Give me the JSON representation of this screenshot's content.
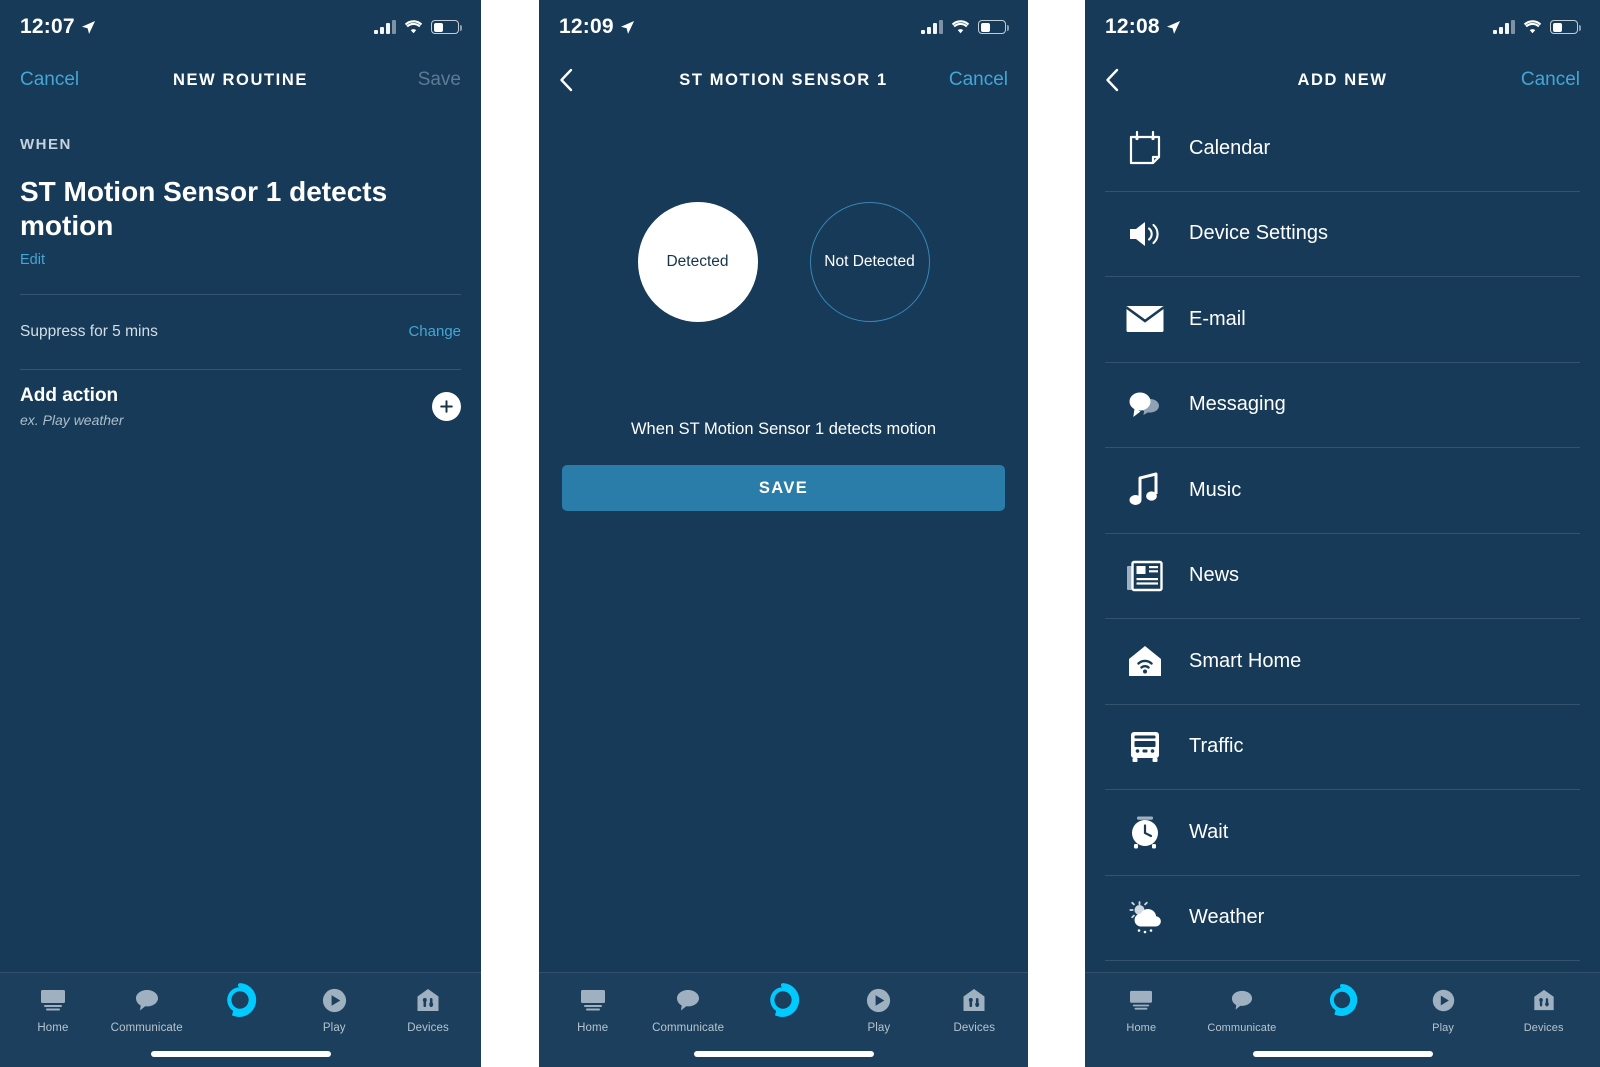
{
  "theme": {
    "bg": "#163a58",
    "accent": "#44a6d4",
    "save_button": "#2b7da9",
    "alexa_ring": "#00caff",
    "tabbar_bg": "#1b3f5d"
  },
  "panel1": {
    "status": {
      "time": "12:07",
      "location_icon": "location-arrow-icon",
      "signal_icon": "cellular-signal-icon",
      "wifi_icon": "wifi-icon",
      "battery_icon": "battery-icon"
    },
    "nav": {
      "left_label": "Cancel",
      "title": "NEW ROUTINE",
      "right_label": "Save"
    },
    "section_label": "WHEN",
    "trigger_title": "ST Motion Sensor 1 detects motion",
    "edit_label": "Edit",
    "suppress": {
      "text": "Suppress for 5 mins",
      "action_label": "Change"
    },
    "add_action": {
      "title": "Add action",
      "subtitle": "ex. Play weather",
      "button_icon": "plus-circle-icon"
    }
  },
  "panel2": {
    "status": {
      "time": "12:09",
      "location_icon": "location-arrow-icon",
      "signal_icon": "cellular-signal-icon",
      "wifi_icon": "wifi-icon",
      "battery_icon": "battery-icon"
    },
    "nav": {
      "back_icon": "chevron-left-icon",
      "title": "ST MOTION SENSOR 1",
      "right_label": "Cancel"
    },
    "options": [
      {
        "label": "Detected",
        "selected": true
      },
      {
        "label": "Not Detected",
        "selected": false
      }
    ],
    "caption": "When ST Motion Sensor 1 detects motion",
    "save_label": "SAVE"
  },
  "panel3": {
    "status": {
      "time": "12:08",
      "location_icon": "location-arrow-icon",
      "signal_icon": "cellular-signal-icon",
      "wifi_icon": "wifi-icon",
      "battery_icon": "battery-icon"
    },
    "nav": {
      "back_icon": "chevron-left-icon",
      "title": "ADD NEW",
      "right_label": "Cancel"
    },
    "items": [
      {
        "label": "Calendar",
        "icon": "calendar-icon"
      },
      {
        "label": "Device Settings",
        "icon": "speaker-volume-icon"
      },
      {
        "label": "E-mail",
        "icon": "envelope-icon"
      },
      {
        "label": "Messaging",
        "icon": "chat-bubbles-icon"
      },
      {
        "label": "Music",
        "icon": "music-note-icon"
      },
      {
        "label": "News",
        "icon": "newspaper-icon"
      },
      {
        "label": "Smart Home",
        "icon": "house-wifi-icon"
      },
      {
        "label": "Traffic",
        "icon": "bus-icon"
      },
      {
        "label": "Wait",
        "icon": "alarm-clock-icon"
      },
      {
        "label": "Weather",
        "icon": "sun-cloud-rain-icon"
      }
    ]
  },
  "tabbar": {
    "items": [
      {
        "label": "Home",
        "icon": "home-device-icon"
      },
      {
        "label": "Communicate",
        "icon": "speech-bubble-icon"
      },
      {
        "label": "",
        "icon": "alexa-ring-icon"
      },
      {
        "label": "Play",
        "icon": "play-circle-icon"
      },
      {
        "label": "Devices",
        "icon": "devices-house-icon"
      }
    ]
  }
}
